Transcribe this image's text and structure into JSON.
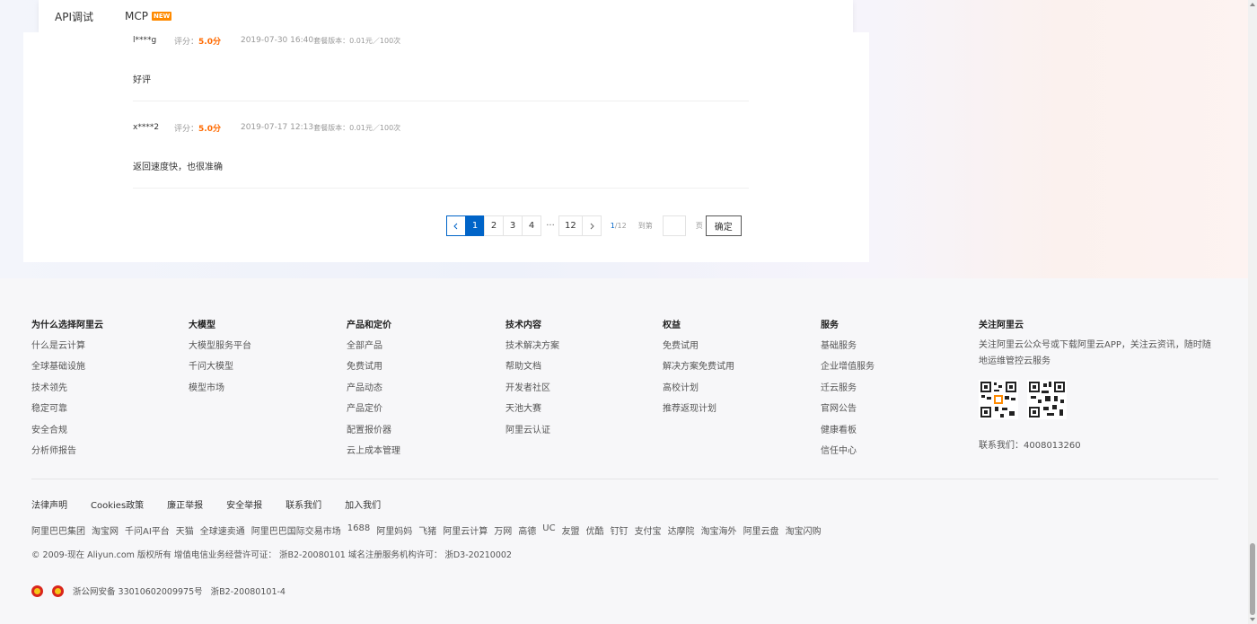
{
  "tabs": {
    "api": "API调试",
    "mcp": "MCP",
    "new_badge": "NEW"
  },
  "reviews": [
    {
      "user": "l****g",
      "score_label": "评分：",
      "score": "5.0分",
      "date": "2019-07-30 16:40",
      "plan": "套餐版本：0.01元／100次",
      "text": "好评"
    },
    {
      "user": "x****2",
      "score_label": "评分：",
      "score": "5.0分",
      "date": "2019-07-17 12:13",
      "plan": "套餐版本：0.01元／100次",
      "text": "返回速度快，也很准确"
    }
  ],
  "pagination": {
    "pages": [
      "1",
      "2",
      "3",
      "4"
    ],
    "ellipsis": "···",
    "last": "12",
    "current": "1",
    "total": "/12",
    "goto_label": "到第",
    "page_label": "页",
    "confirm": "确定"
  },
  "footer": {
    "columns": [
      {
        "title": "为什么选择阿里云",
        "items": [
          "什么是云计算",
          "全球基础设施",
          "技术领先",
          "稳定可靠",
          "安全合规",
          "分析师报告"
        ]
      },
      {
        "title": "大模型",
        "items": [
          "大模型服务平台",
          "千问大模型",
          "模型市场"
        ]
      },
      {
        "title": "产品和定价",
        "items": [
          "全部产品",
          "免费试用",
          "产品动态",
          "产品定价",
          "配置报价器",
          "云上成本管理"
        ]
      },
      {
        "title": "技术内容",
        "items": [
          "技术解决方案",
          "帮助文档",
          "开发者社区",
          "天池大赛",
          "阿里云认证"
        ]
      },
      {
        "title": "权益",
        "items": [
          "免费试用",
          "解决方案免费试用",
          "高校计划",
          "推荐返现计划"
        ]
      },
      {
        "title": "服务",
        "items": [
          "基础服务",
          "企业增值服务",
          "迁云服务",
          "官网公告",
          "健康看板",
          "信任中心"
        ]
      }
    ],
    "follow": {
      "title": "关注阿里云",
      "desc": "关注阿里云公众号或下载阿里云APP，关注云资讯，随时随地运维管控云服务",
      "contact": "联系我们：4008013260"
    },
    "legal": [
      "法律声明",
      "Cookies政策",
      "廉正举报",
      "安全举报",
      "联系我们",
      "加入我们"
    ],
    "links": [
      "阿里巴巴集团",
      "淘宝网",
      "千问AI平台",
      "天猫",
      "全球速卖通",
      "阿里巴巴国际交易市场",
      "1688",
      "阿里妈妈",
      "飞猪",
      "阿里云计算",
      "万网",
      "高德",
      "UC",
      "友盟",
      "优酷",
      "钉钉",
      "支付宝",
      "达摩院",
      "淘宝海外",
      "阿里云盘",
      "淘宝闪购"
    ],
    "copyright": "© 2009-现在 Aliyun.com 版权所有 增值电信业务经营许可证： 浙B2-20080101 域名注册服务机构许可： 浙D3-20210002",
    "beian": "浙公网安备 33010602009975号",
    "beian2": "浙B2-20080101-4"
  }
}
